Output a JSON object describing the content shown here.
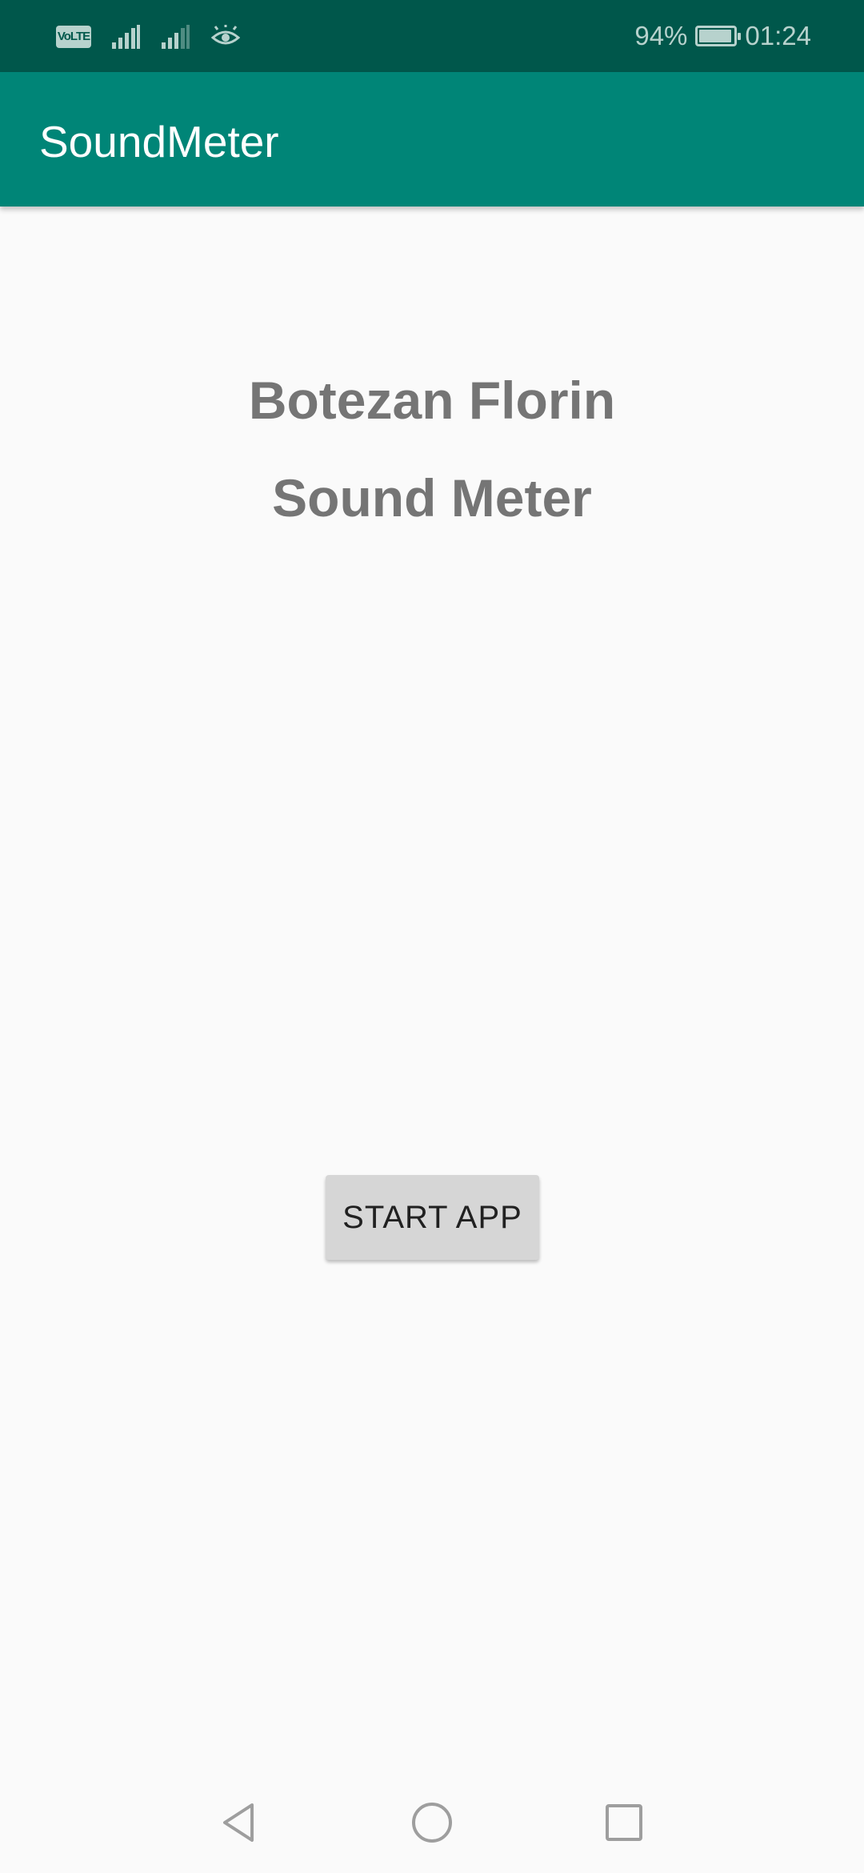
{
  "status_bar": {
    "volte_label": "VoLTE",
    "battery_percent": "94%",
    "battery_level": 0.94,
    "time": "01:24",
    "icons": [
      "volte-icon",
      "signal-icon",
      "signal-icon",
      "eye-icon",
      "battery-icon"
    ]
  },
  "app_bar": {
    "title": "SoundMeter",
    "color": "#008577"
  },
  "main": {
    "heading_line1": "Botezan Florin",
    "heading_line2": "Sound Meter",
    "start_button_label": "START APP"
  },
  "nav_bar": {
    "icons": [
      "back-icon",
      "home-icon",
      "recent-apps-icon"
    ]
  },
  "colors": {
    "status_bar": "#00574b",
    "app_bar": "#008577",
    "background": "#fafafa",
    "heading_text": "#757575",
    "button": "#d6d6d6"
  }
}
